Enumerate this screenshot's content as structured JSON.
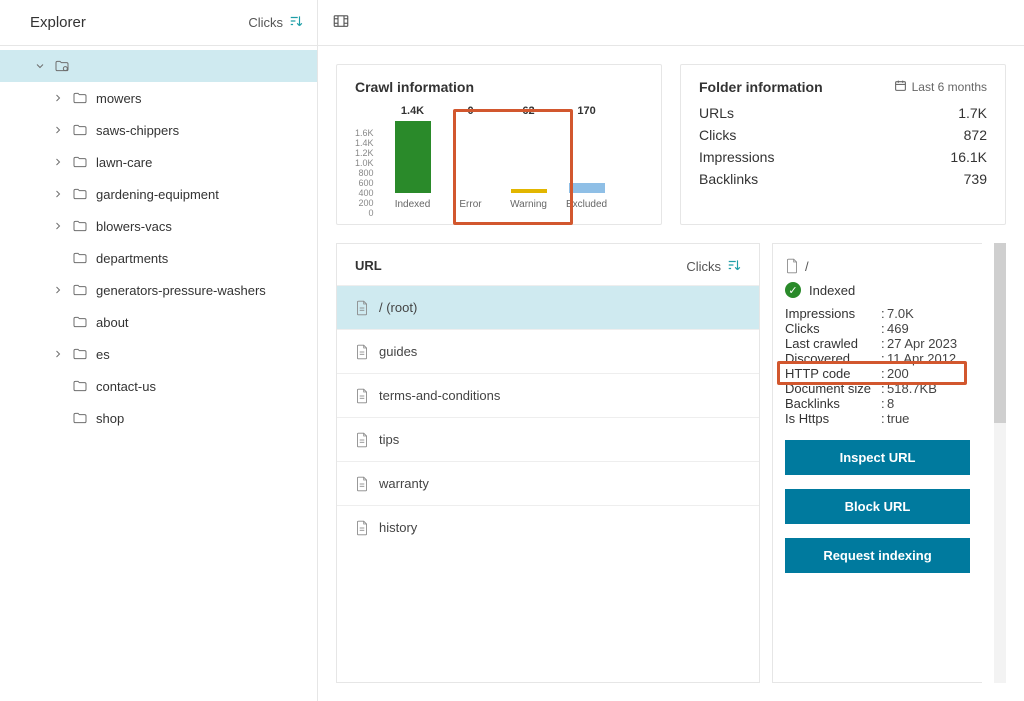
{
  "sidebar": {
    "title": "Explorer",
    "sort_label": "Clicks",
    "tree": [
      {
        "label": "mowers",
        "expandable": true
      },
      {
        "label": "saws-chippers",
        "expandable": true
      },
      {
        "label": "lawn-care",
        "expandable": true
      },
      {
        "label": "gardening-equipment",
        "expandable": true
      },
      {
        "label": "blowers-vacs",
        "expandable": true
      },
      {
        "label": "departments",
        "expandable": false
      },
      {
        "label": "generators-pressure-washers",
        "expandable": true
      },
      {
        "label": "about",
        "expandable": false
      },
      {
        "label": "es",
        "expandable": true
      },
      {
        "label": "contact-us",
        "expandable": false
      },
      {
        "label": "shop",
        "expandable": false
      }
    ]
  },
  "crawl": {
    "title": "Crawl information",
    "axis": [
      "1.6K",
      "1.4K",
      "1.2K",
      "1.0K",
      "800",
      "600",
      "400",
      "200",
      "0"
    ],
    "items": [
      {
        "label": "Indexed",
        "value": "1.4K",
        "color": "#2a8a2a",
        "height": 72
      },
      {
        "label": "Error",
        "value": "0",
        "color": "#c0392b",
        "height": 0
      },
      {
        "label": "Warning",
        "value": "62",
        "color": "#e2b600",
        "height": 4
      },
      {
        "label": "Excluded",
        "value": "170",
        "color": "#8fbfe6",
        "height": 10
      }
    ]
  },
  "chart_data": {
    "type": "bar",
    "title": "Crawl information",
    "categories": [
      "Indexed",
      "Error",
      "Warning",
      "Excluded"
    ],
    "values": [
      1400,
      0,
      62,
      170
    ],
    "ylabel": "",
    "ylim": [
      0,
      1600
    ],
    "colors": [
      "#2a8a2a",
      "#c0392b",
      "#e2b600",
      "#8fbfe6"
    ]
  },
  "folder": {
    "title": "Folder information",
    "range": "Last 6 months",
    "rows": [
      {
        "k": "URLs",
        "v": "1.7K"
      },
      {
        "k": "Clicks",
        "v": "872"
      },
      {
        "k": "Impressions",
        "v": "16.1K"
      },
      {
        "k": "Backlinks",
        "v": "739"
      }
    ]
  },
  "url_list": {
    "header": "URL",
    "sort_label": "Clicks",
    "rows": [
      "/ (root)",
      "guides",
      "terms-and-conditions",
      "tips",
      "warranty",
      "history"
    ]
  },
  "detail": {
    "path": "/",
    "status": "Indexed",
    "meta": [
      {
        "k": "Impressions",
        "v": "7.0K"
      },
      {
        "k": "Clicks",
        "v": "469"
      },
      {
        "k": "Last crawled",
        "v": "27 Apr 2023"
      },
      {
        "k": "Discovered",
        "v": "11 Apr 2012"
      },
      {
        "k": "HTTP code",
        "v": "200"
      },
      {
        "k": "Document size",
        "v": "518.7KB"
      },
      {
        "k": "Backlinks",
        "v": "8"
      },
      {
        "k": "Is Https",
        "v": "true"
      }
    ],
    "actions": {
      "inspect": "Inspect URL",
      "block": "Block URL",
      "request": "Request indexing"
    }
  }
}
